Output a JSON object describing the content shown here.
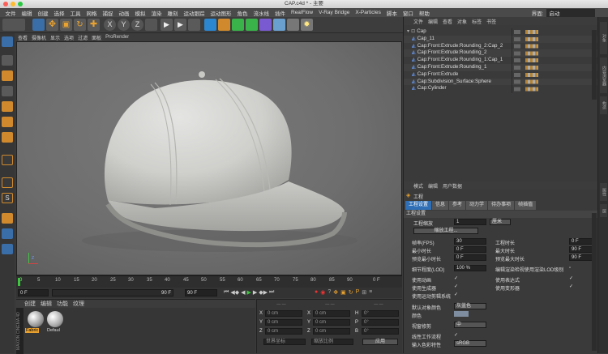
{
  "window": {
    "title": "CAP.c4d * - 主要"
  },
  "menu": [
    "文件",
    "编辑",
    "创建",
    "选择",
    "工具",
    "网格",
    "捕捉",
    "动画",
    "模拟",
    "渲染",
    "雕刻",
    "运动跟踪",
    "运动图形",
    "角色",
    "流水线",
    "插件",
    "RealFlow",
    "V-Ray Bridge",
    "X-Particles",
    "脚本",
    "窗口",
    "帮助"
  ],
  "layout": {
    "label": "界面:",
    "value": "启动"
  },
  "viewport_menu": [
    "查看",
    "摄像机",
    "显示",
    "选项",
    "过滤",
    "面板",
    "ProRender"
  ],
  "axis": {
    "label": "Z"
  },
  "timeline": {
    "ticks": [
      "0",
      "5",
      "10",
      "15",
      "20",
      "25",
      "30",
      "35",
      "40",
      "45",
      "50",
      "55",
      "60",
      "65",
      "70",
      "75",
      "80",
      "85",
      "90"
    ],
    "end_label": "0 F",
    "start_field": "0 F",
    "range_field": "90 F",
    "max_field": "90 F"
  },
  "materials": {
    "menu": [
      "创建",
      "编辑",
      "功能",
      "纹理"
    ],
    "items": [
      {
        "name": "Fabric"
      },
      {
        "name": "Defaul"
      }
    ],
    "brand": "MAXON CINEMA 4D"
  },
  "coords": {
    "rows": [
      {
        "axis": "X",
        "pos": "0 cm",
        "axis2": "X",
        "size": "0 cm",
        "rot": "H",
        "rot_val": "0°"
      },
      {
        "axis": "Y",
        "pos": "0 cm",
        "axis2": "Y",
        "size": "0 cm",
        "rot": "P",
        "rot_val": "0°"
      },
      {
        "axis": "Z",
        "pos": "0 cm",
        "axis2": "Z",
        "size": "0 cm",
        "rot": "B",
        "rot_val": "0°"
      }
    ],
    "mode": "世界坐标",
    "scale_mode": "缩放比例",
    "apply": "应用"
  },
  "objects": {
    "menu": [
      "文件",
      "编辑",
      "查看",
      "对象",
      "标签",
      "书签"
    ],
    "items": [
      {
        "name": "Cap",
        "indent": 0
      },
      {
        "name": "Cap_11",
        "indent": 1
      },
      {
        "name": "Cap:Front:Extrude:Rounding_2:Cap_2",
        "indent": 1
      },
      {
        "name": "Cap:Front:Extrude:Rounding_2",
        "indent": 1
      },
      {
        "name": "Cap:Front:Extrude:Rounding_1:Cap_1",
        "indent": 1
      },
      {
        "name": "Cap:Front:Extrude:Rounding_1",
        "indent": 1
      },
      {
        "name": "Cap:Front:Extrude",
        "indent": 1
      },
      {
        "name": "Cap:Subdivision_Surface:Sphere",
        "indent": 1
      },
      {
        "name": "Cap:Cylinder",
        "indent": 1
      }
    ]
  },
  "attributes": {
    "menu": [
      "模式",
      "编辑",
      "用户数据"
    ],
    "title": "工程",
    "tabs": [
      "工程设置",
      "信息",
      "参考",
      "动力学",
      "待办事项",
      "帧插值"
    ],
    "section": "工程设置",
    "scale_label": "工程缩放",
    "scale_value": "1",
    "scale_unit": "厘米",
    "scale_button": "缩放工程...",
    "fps_label": "帧率(FPS)",
    "fps_value": "30",
    "duration_label": "工程时长",
    "duration_value": "0 F",
    "min_label": "最小时长",
    "min_value": "0 F",
    "max_label": "最大时长",
    "max_value": "90 F",
    "pmin_label": "预览最小时长",
    "pmin_value": "0 F",
    "pmax_label": "预览最大时长",
    "pmax_value": "90 F",
    "lod_label": "细节程度(LOD)",
    "lod_value": "100 %",
    "lod_check_label": "编辑渲染检视使用渲染LOD级别",
    "checks_left": [
      "使用动画",
      "使用生成器",
      "使用运动剪辑系统"
    ],
    "checks_right": [
      "使用表达式",
      "使用变形器"
    ],
    "default_color_label": "默认对象颜色",
    "default_color_value": "灰蓝色",
    "color_label": "颜色",
    "view_clip_label": "视窗修剪",
    "view_clip_value": "中",
    "linear_label": "线性工作流程",
    "input_color_label": "输入色彩特性",
    "input_color_value": "sRGB"
  },
  "edge_tabs": [
    "对象",
    "内容浏览器",
    "构造",
    "属性",
    "层"
  ]
}
